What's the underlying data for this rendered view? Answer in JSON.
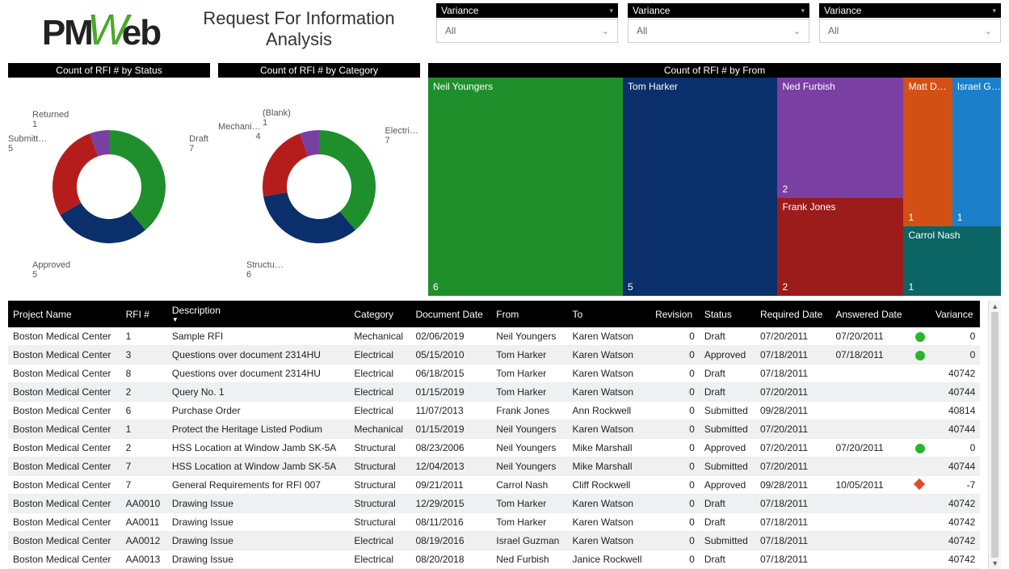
{
  "logo": {
    "part1": "PM",
    "part_w": "W",
    "part3": "eb"
  },
  "title": "Request For Information Analysis",
  "filters": [
    {
      "label": "Variance",
      "value": "All"
    },
    {
      "label": "Variance",
      "value": "All"
    },
    {
      "label": "Variance",
      "value": "All"
    }
  ],
  "chart_data": [
    {
      "type": "pie",
      "title": "Count of RFI # by Status",
      "series": [
        {
          "name": "Draft",
          "value": 7,
          "color": "#1f8f2c"
        },
        {
          "name": "Approved",
          "value": 5,
          "color": "#0a2f6b"
        },
        {
          "name": "Submitted",
          "value": 5,
          "color": "#b51d1d"
        },
        {
          "name": "Returned",
          "value": 1,
          "color": "#7a3fa3"
        }
      ]
    },
    {
      "type": "pie",
      "title": "Count of RFI # by Category",
      "series": [
        {
          "name": "Electrical",
          "value": 7,
          "color": "#1f8f2c"
        },
        {
          "name": "Structural",
          "value": 6,
          "color": "#0a2f6b"
        },
        {
          "name": "Mechanical",
          "value": 4,
          "color": "#b51d1d"
        },
        {
          "name": "(Blank)",
          "value": 1,
          "color": "#7a3fa3"
        }
      ]
    },
    {
      "type": "treemap",
      "title": "Count of RFI # by From",
      "series": [
        {
          "name": "Neil Youngers",
          "value": 6,
          "color": "#1f8f2c"
        },
        {
          "name": "Tom Harker",
          "value": 5,
          "color": "#0a2f6b"
        },
        {
          "name": "Ned Furbish",
          "value": 2,
          "color": "#7a3fa3"
        },
        {
          "name": "Frank Jones",
          "value": 2,
          "color": "#9c1b1b"
        },
        {
          "name": "Matt D…",
          "value": 1,
          "color": "#d35015",
          "short": true
        },
        {
          "name": "Israel G…",
          "value": 1,
          "color": "#1c7fc9",
          "short": true
        },
        {
          "name": "Carrol Nash",
          "value": 1,
          "color": "#0b6565"
        }
      ]
    }
  ],
  "table": {
    "columns": [
      "Project Name",
      "RFI #",
      "Description",
      "Category",
      "Document Date",
      "From",
      "To",
      "Revision",
      "Status",
      "Required Date",
      "Answered Date",
      "",
      "Variance"
    ],
    "rows": [
      [
        "Boston Medical Center",
        "1",
        "Sample RFI",
        "Mechanical",
        "02/06/2019",
        "Neil Youngers",
        "Karen Watson",
        "0",
        "Draft",
        "07/20/2011",
        "07/20/2011",
        "green",
        "0"
      ],
      [
        "Boston Medical Center",
        "3",
        "Questions over document 2314HU",
        "Electrical",
        "05/15/2010",
        "Tom Harker",
        "Karen Watson",
        "0",
        "Approved",
        "07/18/2011",
        "07/18/2011",
        "green",
        "0"
      ],
      [
        "Boston Medical Center",
        "8",
        "Questions over document 2314HU",
        "Electrical",
        "06/18/2015",
        "Tom Harker",
        "Karen Watson",
        "0",
        "Draft",
        "07/18/2011",
        "",
        "",
        "40742"
      ],
      [
        "Boston Medical Center",
        "2",
        "Query No. 1",
        "Electrical",
        "01/15/2019",
        "Tom Harker",
        "Karen Watson",
        "0",
        "Draft",
        "07/20/2011",
        "",
        "",
        "40744"
      ],
      [
        "Boston Medical Center",
        "6",
        "Purchase Order",
        "Electrical",
        "11/07/2013",
        "Frank Jones",
        "Ann Rockwell",
        "0",
        "Submitted",
        "09/28/2011",
        "",
        "",
        "40814"
      ],
      [
        "Boston Medical Center",
        "1",
        "Protect the Heritage Listed Podium",
        "Mechanical",
        "01/15/2019",
        "Neil Youngers",
        "Karen Watson",
        "0",
        "Submitted",
        "07/20/2011",
        "",
        "",
        "40744"
      ],
      [
        "Boston Medical Center",
        "2",
        "HSS Location at Window Jamb SK-5A",
        "Structural",
        "08/23/2006",
        "Neil Youngers",
        "Mike Marshall",
        "0",
        "Approved",
        "07/20/2011",
        "07/20/2011",
        "green",
        "0"
      ],
      [
        "Boston Medical Center",
        "7",
        "HSS Location at Window Jamb SK-5A",
        "Structural",
        "12/04/2013",
        "Neil Youngers",
        "Mike Marshall",
        "0",
        "Submitted",
        "07/20/2011",
        "",
        "",
        "40744"
      ],
      [
        "Boston Medical Center",
        "7",
        "General Requirements for RFI 007",
        "Structural",
        "09/21/2011",
        "Carrol Nash",
        "Cliff Rockwell",
        "0",
        "Approved",
        "09/28/2011",
        "10/05/2011",
        "red",
        "-7"
      ],
      [
        "Boston Medical Center",
        "AA0010",
        "Drawing Issue",
        "Structural",
        "12/29/2015",
        "Tom Harker",
        "Karen Watson",
        "0",
        "Draft",
        "07/18/2011",
        "",
        "",
        "40742"
      ],
      [
        "Boston Medical Center",
        "AA0011",
        "Drawing Issue",
        "Structural",
        "08/11/2016",
        "Tom Harker",
        "Karen Watson",
        "0",
        "Draft",
        "07/18/2011",
        "",
        "",
        "40742"
      ],
      [
        "Boston Medical Center",
        "AA0012",
        "Drawing Issue",
        "Electrical",
        "08/19/2016",
        "Israel Guzman",
        "Karen Watson",
        "0",
        "Submitted",
        "07/18/2011",
        "",
        "",
        "40742"
      ],
      [
        "Boston Medical Center",
        "AA0013",
        "Drawing Issue",
        "Electrical",
        "08/20/2018",
        "Ned Furbish",
        "Janice Rockwell",
        "0",
        "Draft",
        "07/18/2011",
        "",
        "",
        "40742"
      ]
    ]
  }
}
